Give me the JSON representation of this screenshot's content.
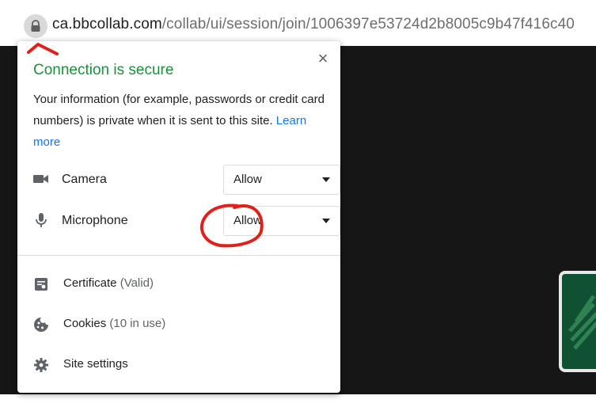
{
  "address_bar": {
    "host": "ca.bbcollab.com",
    "path": "/collab/ui/session/join/1006397e53724d2b8005c9b47f416c40",
    "lock_icon": "lock-icon"
  },
  "popup": {
    "title": "Connection is secure",
    "close_label": "×",
    "description": "Your information (for example, passwords or credit card numbers) is private when it is sent to this site.",
    "learn_more": "Learn more",
    "permissions": [
      {
        "label": "Camera",
        "value": "Allow",
        "icon": "camera-icon"
      },
      {
        "label": "Microphone",
        "value": "Allow",
        "icon": "microphone-icon"
      }
    ],
    "items": [
      {
        "label": "Certificate",
        "sub": "(Valid)",
        "icon": "certificate-icon"
      },
      {
        "label": "Cookies",
        "sub": "(10 in use)",
        "icon": "cookie-icon"
      },
      {
        "label": "Site settings",
        "sub": "",
        "icon": "gear-icon"
      }
    ]
  },
  "colors": {
    "secure_green": "#1e8e3e",
    "link_blue": "#1a73e8",
    "annotation_red": "#e0201b"
  }
}
